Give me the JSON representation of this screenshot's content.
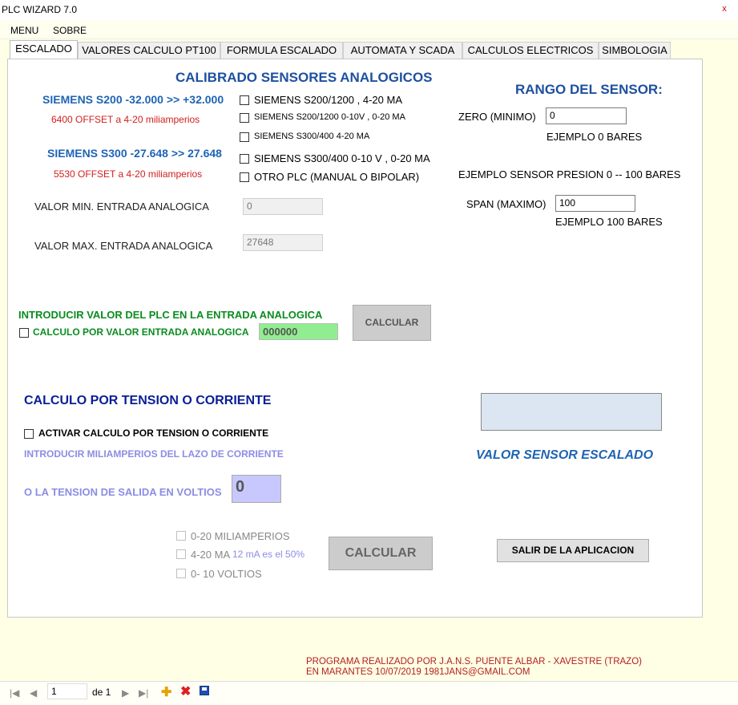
{
  "window": {
    "title": "PLC WIZARD 7.0",
    "close": "x"
  },
  "menu": {
    "items": [
      "MENU",
      "SOBRE"
    ]
  },
  "tabs": [
    "ESCALADO",
    "VALORES CALCULO PT100",
    "FORMULA ESCALADO",
    "AUTOMATA Y SCADA",
    "CALCULOS ELECTRICOS",
    "SIMBOLOGIA"
  ],
  "calib": {
    "title": "CALIBRADO SENSORES ANALOGICOS",
    "s200_range": "SIEMENS S200 -32.000 >> +32.000",
    "s200_offset": "6400 OFFSET  a 4-20 miliamperios",
    "s300_range": "SIEMENS S300 -27.648 >> 27.648",
    "s300_offset": "5530 OFFSET  a 4-20 miliamperios",
    "options": [
      "SIEMENS S200/1200 , 4-20 MA",
      "SIEMENS S200/1200 0-10V , 0-20 MA",
      "SIEMENS S300/400  4-20 MA",
      "SIEMENS S300/400 0-10 V , 0-20 MA",
      "OTRO PLC (MANUAL O BIPOLAR)"
    ],
    "min_label": "VALOR MIN. ENTRADA ANALOGICA",
    "min_value": "0",
    "max_label": "VALOR MAX. ENTRADA ANALOGICA",
    "max_value": "27648"
  },
  "sensor": {
    "title": "RANGO DEL SENSOR:",
    "zero_label": "ZERO  (MINIMO)",
    "zero_value": "0",
    "zero_example": "EJEMPLO  0 BARES",
    "example": "EJEMPLO SENSOR PRESION 0 -- 100 BARES",
    "span_label": "SPAN (MAXIMO)",
    "span_value": "100",
    "span_example": "EJEMPLO  100 BARES"
  },
  "plc_input": {
    "title": "INTRODUCIR VALOR DEL PLC EN LA ENTRADA ANALOGICA",
    "checkbox": "CALCULO POR VALOR ENTRADA ANALOGICA",
    "value": "000000",
    "button": "CALCULAR"
  },
  "tension": {
    "title": "CALCULO POR TENSION O CORRIENTE",
    "activate": "ACTIVAR CALCULO POR TENSION O CORRIENTE",
    "ma_label": "INTRODUCIR MILIAMPERIOS DEL LAZO DE CORRIENTE",
    "volt_label": "O LA TENSION DE SALIDA EN VOLTIOS",
    "value": "0",
    "opt1": "0-20 MILIAMPERIOS",
    "opt2": "4-20 MA",
    "opt2_note": "12 mA es el 50%",
    "opt3": "0- 10 VOLTIOS",
    "button": "CALCULAR"
  },
  "result": {
    "label": "VALOR SENSOR ESCALADO",
    "value": ""
  },
  "exit_button": "SALIR DE LA APLICACION",
  "credits": {
    "line1": "PROGRAMA REALIZADO POR J.A.N.S.  PUENTE ALBAR - XAVESTRE  (TRAZO)",
    "line2": "EN MARANTES 10/07/2019  1981JANS@GMAIL.COM"
  },
  "navigator": {
    "position": "1",
    "of_label": "de 1"
  },
  "colors": {
    "accent_blue": "#1e50a0",
    "offset_red": "#d21e1e",
    "plc_green": "#0a8c1e",
    "input_green": "#90ee90",
    "lavender": "#8c8ce6",
    "result_box": "#dce6f2"
  }
}
